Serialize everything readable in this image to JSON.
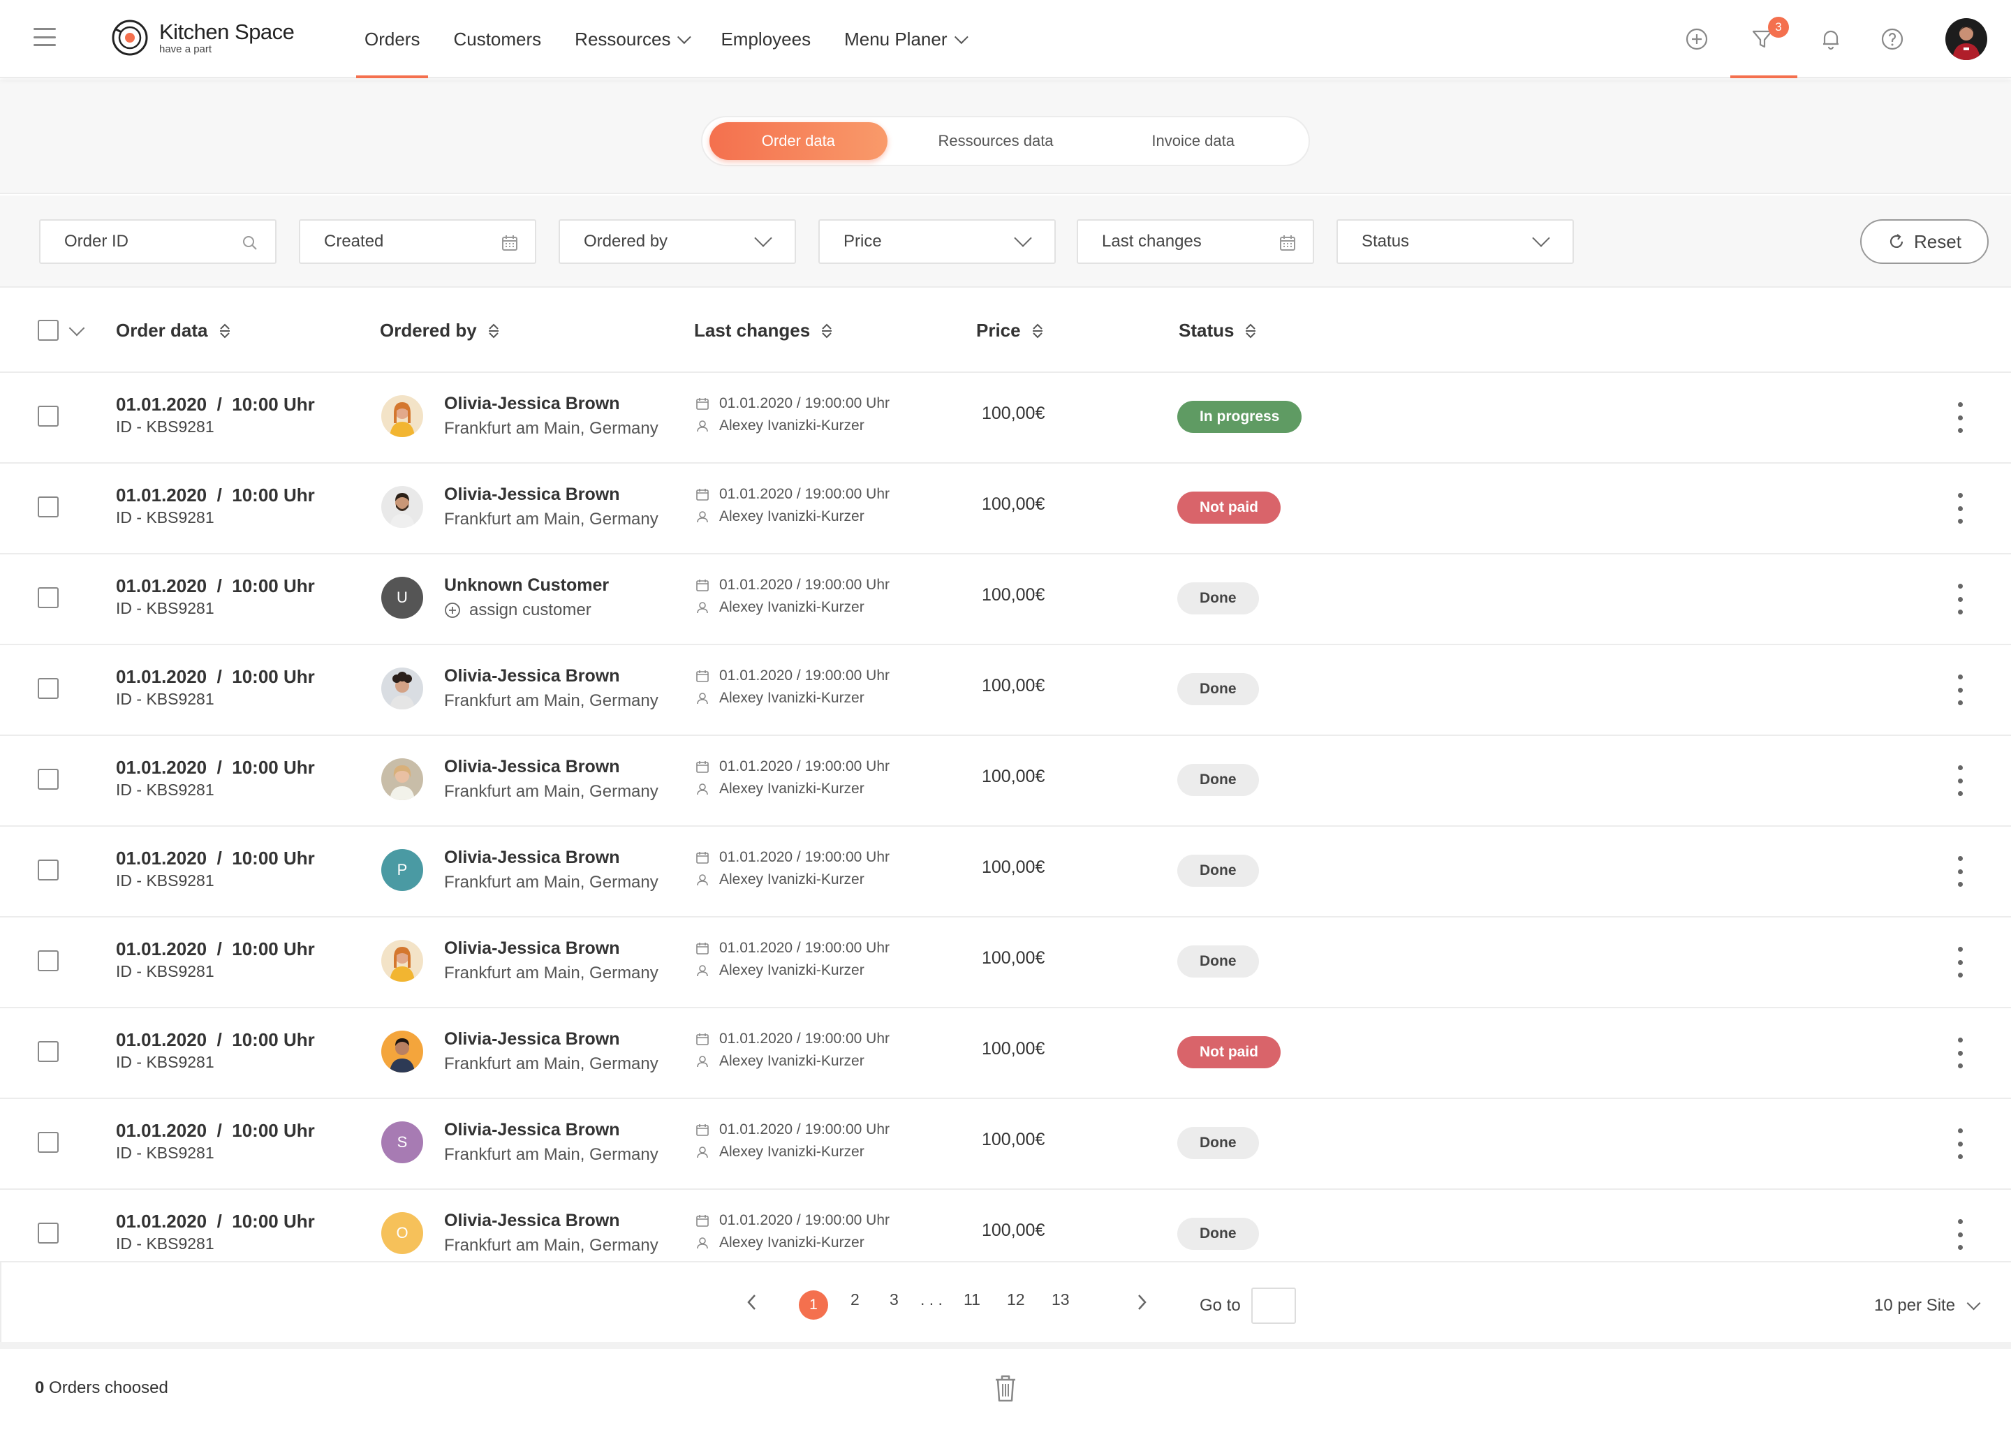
{
  "app": {
    "name": "Kitchen Space",
    "tagline": "have a part"
  },
  "nav": [
    {
      "label": "Orders",
      "active": true,
      "dropdown": false
    },
    {
      "label": "Customers",
      "active": false,
      "dropdown": false
    },
    {
      "label": "Ressources",
      "active": false,
      "dropdown": true
    },
    {
      "label": "Employees",
      "active": false,
      "dropdown": false
    },
    {
      "label": "Menu Planer",
      "active": false,
      "dropdown": true
    }
  ],
  "header_icons": {
    "filter_badge": "3"
  },
  "tabs": [
    {
      "label": "Order data",
      "active": true
    },
    {
      "label": "Ressources data",
      "active": false
    },
    {
      "label": "Invoice data",
      "active": false
    }
  ],
  "filters": {
    "order_id": "Order ID",
    "created": "Created",
    "ordered_by": "Ordered by",
    "price": "Price",
    "last_changes": "Last changes",
    "status": "Status",
    "reset": "Reset"
  },
  "columns": {
    "order_data": "Order data",
    "ordered_by": "Ordered by",
    "last_changes": "Last changes",
    "price": "Price",
    "status": "Status"
  },
  "rows": [
    {
      "date": "01.01.2020  /  10:00 Uhr",
      "id": "ID - KBS9281",
      "name": "Olivia-Jessica Brown",
      "location": "Frankfurt am Main, Germany",
      "avatar": "photo-yellow",
      "changed": "01.01.2020 / 19:00:00 Uhr",
      "changed_by": "Alexey Ivanizki-Kurzer",
      "price": "100,00€",
      "status": "In progress",
      "status_kind": "progress"
    },
    {
      "date": "01.01.2020  /  10:00 Uhr",
      "id": "ID - KBS9281",
      "name": "Olivia-Jessica Brown",
      "location": "Frankfurt am Main, Germany",
      "avatar": "photo-beard",
      "changed": "01.01.2020 / 19:00:00 Uhr",
      "changed_by": "Alexey Ivanizki-Kurzer",
      "price": "100,00€",
      "status": "Not paid",
      "status_kind": "notpaid"
    },
    {
      "date": "01.01.2020  /  10:00 Uhr",
      "id": "ID - KBS9281",
      "name": "Unknown Customer",
      "location": "assign customer",
      "avatar": "U",
      "avatar_color": "#555555",
      "assign": true,
      "changed": "01.01.2020 / 19:00:00 Uhr",
      "changed_by": "Alexey Ivanizki-Kurzer",
      "price": "100,00€",
      "status": "Done",
      "status_kind": "done"
    },
    {
      "date": "01.01.2020  /  10:00 Uhr",
      "id": "ID - KBS9281",
      "name": "Olivia-Jessica Brown",
      "location": "Frankfurt am Main, Germany",
      "avatar": "photo-curly",
      "changed": "01.01.2020 / 19:00:00 Uhr",
      "changed_by": "Alexey Ivanizki-Kurzer",
      "price": "100,00€",
      "status": "Done",
      "status_kind": "done"
    },
    {
      "date": "01.01.2020  /  10:00 Uhr",
      "id": "ID - KBS9281",
      "name": "Olivia-Jessica Brown",
      "location": "Frankfurt am Main, Germany",
      "avatar": "photo-blond",
      "changed": "01.01.2020 / 19:00:00 Uhr",
      "changed_by": "Alexey Ivanizki-Kurzer",
      "price": "100,00€",
      "status": "Done",
      "status_kind": "done"
    },
    {
      "date": "01.01.2020  /  10:00 Uhr",
      "id": "ID - KBS9281",
      "name": "Olivia-Jessica Brown",
      "location": "Frankfurt am Main, Germany",
      "avatar": "P",
      "avatar_color": "#4a9aa3",
      "changed": "01.01.2020 / 19:00:00 Uhr",
      "changed_by": "Alexey Ivanizki-Kurzer",
      "price": "100,00€",
      "status": "Done",
      "status_kind": "done"
    },
    {
      "date": "01.01.2020  /  10:00 Uhr",
      "id": "ID - KBS9281",
      "name": "Olivia-Jessica Brown",
      "location": "Frankfurt am Main, Germany",
      "avatar": "photo-yellow",
      "changed": "01.01.2020 / 19:00:00 Uhr",
      "changed_by": "Alexey Ivanizki-Kurzer",
      "price": "100,00€",
      "status": "Done",
      "status_kind": "done"
    },
    {
      "date": "01.01.2020  /  10:00 Uhr",
      "id": "ID - KBS9281",
      "name": "Olivia-Jessica Brown",
      "location": "Frankfurt am Main, Germany",
      "avatar": "photo-orange",
      "changed": "01.01.2020 / 19:00:00 Uhr",
      "changed_by": "Alexey Ivanizki-Kurzer",
      "price": "100,00€",
      "status": "Not paid",
      "status_kind": "notpaid"
    },
    {
      "date": "01.01.2020  /  10:00 Uhr",
      "id": "ID - KBS9281",
      "name": "Olivia-Jessica Brown",
      "location": "Frankfurt am Main, Germany",
      "avatar": "S",
      "avatar_color": "#a77bb3",
      "changed": "01.01.2020 / 19:00:00 Uhr",
      "changed_by": "Alexey Ivanizki-Kurzer",
      "price": "100,00€",
      "status": "Done",
      "status_kind": "done"
    },
    {
      "date": "01.01.2020  /  10:00 Uhr",
      "id": "ID - KBS9281",
      "name": "Olivia-Jessica Brown",
      "location": "Frankfurt am Main, Germany",
      "avatar": "O",
      "avatar_color": "#f6c15a",
      "changed": "01.01.2020 / 19:00:00 Uhr",
      "changed_by": "Alexey Ivanizki-Kurzer",
      "price": "100,00€",
      "status": "Done",
      "status_kind": "done"
    }
  ],
  "pagination": {
    "pages": [
      "1",
      "2",
      "3",
      ". . .",
      "11",
      "12",
      "13"
    ],
    "active": "1",
    "goto_label": "Go to",
    "goto_value": "",
    "per_site": "10 per Site"
  },
  "footer": {
    "count": "0",
    "label": "Orders choosed"
  },
  "colors": {
    "accent": "#f4704e",
    "progress": "#5f9b63",
    "notpaid": "#d9646a",
    "done": "#ececec"
  }
}
